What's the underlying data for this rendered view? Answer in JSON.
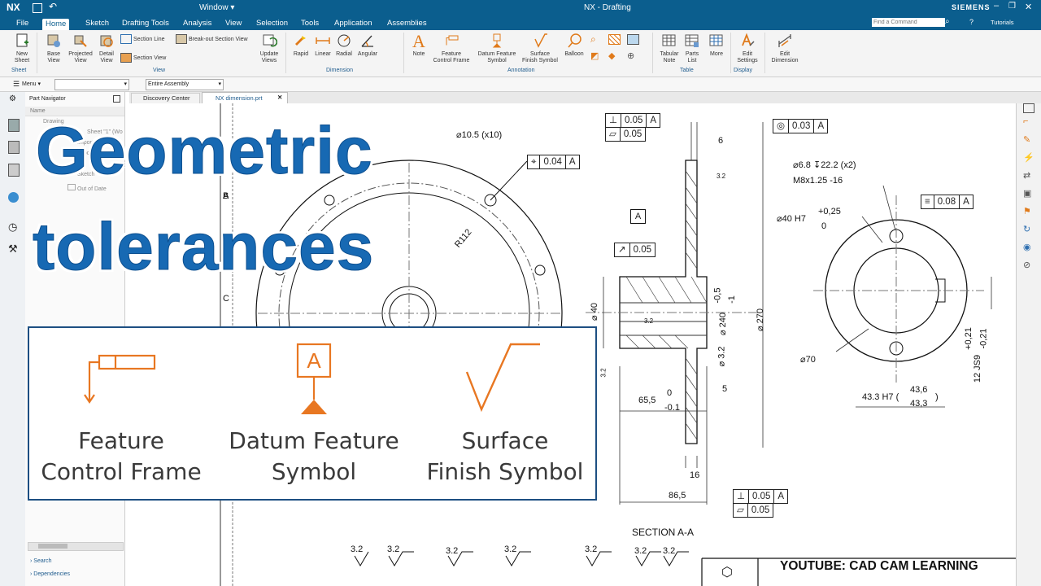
{
  "titlebar": {
    "app_logo": "NX",
    "window_label": "Window",
    "title": "NX - Drafting",
    "brand": "SIEMENS"
  },
  "menubar": {
    "items": [
      "File",
      "Home",
      "Sketch",
      "Drafting Tools",
      "Analysis",
      "View",
      "Selection",
      "Tools",
      "Application",
      "Assemblies"
    ],
    "active": "Home",
    "find_command_placeholder": "Find a Command",
    "tutorials": "Tutorials"
  },
  "ribbon": {
    "buttons": {
      "new_sheet": "New\nSheet",
      "base_view": "Base\nView",
      "projected_view": "Projected\nView",
      "detail_view": "Detail\nView",
      "section_line": "Section Line",
      "section_view": "Section View",
      "breakout_section_view": "Break-out Section View",
      "update_views": "Update\nViews",
      "rapid": "Rapid",
      "linear": "Linear",
      "radial": "Radial",
      "angular": "Angular",
      "note": "Note",
      "feature_control_frame": "Feature\nControl Frame",
      "datum_feature_symbol": "Datum Feature\nSymbol",
      "surface_finish_symbol": "Surface\nFinish Symbol",
      "balloon": "Balloon",
      "tabular_note": "Tabular\nNote",
      "parts_list": "Parts\nList",
      "more": "More",
      "edit_settings": "Edit\nSettings",
      "edit_dimension": "Edit\nDimension"
    },
    "groups": {
      "sheet": "Sheet",
      "view": "View",
      "dimension": "Dimension",
      "annotation": "Annotation",
      "table": "Table",
      "display": "Display"
    }
  },
  "cmdbar": {
    "menu": "Menu",
    "filter_value": "",
    "assembly_scope": "Entire Assembly"
  },
  "tabs": [
    {
      "label": "Discovery Center"
    },
    {
      "label": "NX dimension.prt",
      "active": true
    }
  ],
  "part_navigator": {
    "title": "Part Navigator",
    "name_col": "Name",
    "items": [
      "Drawing",
      "Sheet \"1\" (Wo",
      "Imported \"",
      "Imported \"",
      "Sketch \"SKET",
      "Out of Date"
    ],
    "footer": [
      "Search",
      "Dependencies"
    ]
  },
  "overlay": {
    "line1": "Geometric",
    "line2": "tolerances"
  },
  "callout": {
    "items": [
      {
        "line1": "Feature",
        "line2": "Control Frame",
        "icon": "feature-control-frame-icon"
      },
      {
        "line1": "Datum Feature",
        "line2": "Symbol",
        "icon": "datum-feature-symbol-icon",
        "letter": "A"
      },
      {
        "line1": "Surface",
        "line2": "Finish Symbol",
        "icon": "surface-finish-symbol-icon"
      }
    ],
    "accent": "#e87722"
  },
  "drawing": {
    "zone_letters": [
      "A",
      "B",
      "C"
    ],
    "left_view": {
      "hole_note": "10.5  (x10)",
      "position_fcf": [
        "0.04",
        "A"
      ],
      "radius_label": "R112",
      "section_letter": "A"
    },
    "section_view": {
      "perp_fcf": [
        "0.05",
        "A"
      ],
      "flat_fcf": [
        "0.05"
      ],
      "datum_letter": "A",
      "runout_fcf": [
        "0.05"
      ],
      "dims": {
        "d6": "6",
        "d270": "270",
        "d240": "240",
        "d240_tol_up": "-0,5",
        "d240_tol_lo": "-1",
        "d40": "40",
        "d32a": "3.2",
        "d32b": "3.2",
        "d32c": "3.2",
        "d32d": "3.2",
        "d65": "65,5",
        "d65_up": "0",
        "d65_lo": "-0.1",
        "d5": "5",
        "d16": "16",
        "d86": "86,5"
      },
      "bottom_perp_fcf": [
        "0.05",
        "A"
      ],
      "bottom_flat_fcf": [
        "0.05"
      ],
      "section_label": "SECTION A-A"
    },
    "right_view": {
      "conc_fcf": [
        "0.03",
        "A"
      ],
      "hole_note1": "6.8  ↧22.2  (x2)",
      "hole_note2": "M8x1.25 -16",
      "d40": "40 H7",
      "d40_up": "+0,25",
      "d40_lo": "0",
      "sym_fcf": [
        "0.08",
        "A"
      ],
      "d70": "70",
      "key_width": "12 JS9",
      "key_up": "+0,21",
      "key_lo": "-0,21",
      "key_depth": "43.3 H7 (",
      "key_up2": "43,6",
      "key_lo2": "43,3"
    },
    "surface_symbols": [
      "3.2",
      "3.2",
      "3.2",
      "3.2",
      "3.2",
      "3.2",
      "3.2"
    ],
    "title_block": "YOUTUBE: CAD CAM LEARNING"
  }
}
